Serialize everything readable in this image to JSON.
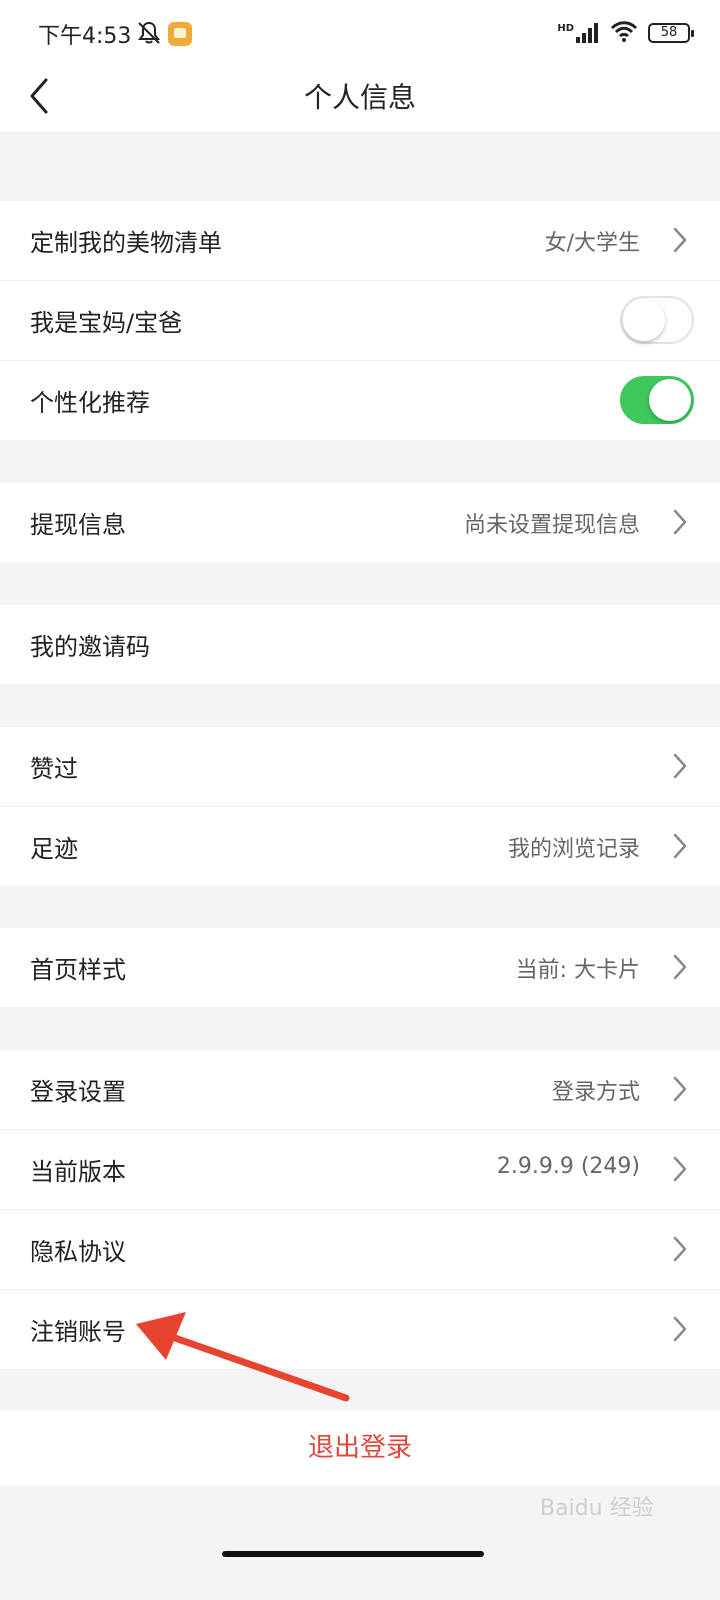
{
  "status": {
    "time": "下午4:53",
    "hd_label": "HD",
    "battery": "58"
  },
  "nav": {
    "title": "个人信息"
  },
  "groups": [
    {
      "rows": [
        {
          "label": "定制我的美物清单",
          "value": "女/大学生",
          "chevron": true
        },
        {
          "label": "我是宝妈/宝爸",
          "toggle": "off"
        },
        {
          "label": "个性化推荐",
          "toggle": "on"
        }
      ]
    },
    {
      "rows": [
        {
          "label": "提现信息",
          "value": "尚未设置提现信息",
          "chevron": true
        }
      ]
    },
    {
      "rows": [
        {
          "label": "我的邀请码"
        }
      ]
    },
    {
      "rows": [
        {
          "label": "赞过",
          "chevron": true
        },
        {
          "label": "足迹",
          "value": "我的浏览记录",
          "chevron": true
        }
      ]
    },
    {
      "rows": [
        {
          "label": "首页样式",
          "value": "当前: 大卡片",
          "chevron": true
        }
      ]
    },
    {
      "rows": [
        {
          "label": "登录设置",
          "value": "登录方式",
          "chevron": true
        },
        {
          "label": "当前版本",
          "value": "2.9.9.9 (249)",
          "chevron": true
        },
        {
          "label": "隐私协议",
          "chevron": true
        },
        {
          "label": "注销账号",
          "chevron": true
        }
      ]
    }
  ],
  "logout_label": "退出登录",
  "watermark": "Baidu 经验",
  "colors": {
    "toggle_on": "#3ec95a",
    "logout_text": "#e0473a",
    "annotation_arrow": "#e8432e",
    "background": "#f4f4f6"
  }
}
